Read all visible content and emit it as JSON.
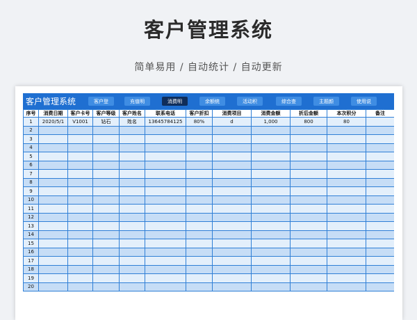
{
  "page": {
    "title": "客户管理系统",
    "subtitle": "简单易用  /  自动统计  /  自动更新"
  },
  "app": {
    "title": "客户管理系统",
    "nav": [
      "客户登",
      "充值明",
      "消费明",
      "余额统",
      "活动积",
      "综合查",
      "主题颜",
      "使用说"
    ],
    "active_tab": "消费明"
  },
  "table": {
    "headers": [
      "序号",
      "消费日期",
      "客户卡号",
      "客户等级",
      "客户姓名",
      "联系电话",
      "客户折扣",
      "消费项目",
      "消费金额",
      "折后金额",
      "本次积分",
      "备注"
    ],
    "rows": [
      [
        "1",
        "2020/5/1",
        "V1001",
        "钻石",
        "姓名",
        "13645784125",
        "80%",
        "d",
        "1,000",
        "800",
        "80",
        ""
      ],
      [
        "2",
        "",
        "",
        "",
        "",
        "",
        "",
        "",
        "",
        "",
        "",
        ""
      ],
      [
        "3",
        "",
        "",
        "",
        "",
        "",
        "",
        "",
        "",
        "",
        "",
        ""
      ],
      [
        "4",
        "",
        "",
        "",
        "",
        "",
        "",
        "",
        "",
        "",
        "",
        ""
      ],
      [
        "5",
        "",
        "",
        "",
        "",
        "",
        "",
        "",
        "",
        "",
        "",
        ""
      ],
      [
        "6",
        "",
        "",
        "",
        "",
        "",
        "",
        "",
        "",
        "",
        "",
        ""
      ],
      [
        "7",
        "",
        "",
        "",
        "",
        "",
        "",
        "",
        "",
        "",
        "",
        ""
      ],
      [
        "8",
        "",
        "",
        "",
        "",
        "",
        "",
        "",
        "",
        "",
        "",
        ""
      ],
      [
        "9",
        "",
        "",
        "",
        "",
        "",
        "",
        "",
        "",
        "",
        "",
        ""
      ],
      [
        "10",
        "",
        "",
        "",
        "",
        "",
        "",
        "",
        "",
        "",
        "",
        ""
      ],
      [
        "11",
        "",
        "",
        "",
        "",
        "",
        "",
        "",
        "",
        "",
        "",
        ""
      ],
      [
        "12",
        "",
        "",
        "",
        "",
        "",
        "",
        "",
        "",
        "",
        "",
        ""
      ],
      [
        "13",
        "",
        "",
        "",
        "",
        "",
        "",
        "",
        "",
        "",
        "",
        ""
      ],
      [
        "14",
        "",
        "",
        "",
        "",
        "",
        "",
        "",
        "",
        "",
        "",
        ""
      ],
      [
        "15",
        "",
        "",
        "",
        "",
        "",
        "",
        "",
        "",
        "",
        "",
        ""
      ],
      [
        "16",
        "",
        "",
        "",
        "",
        "",
        "",
        "",
        "",
        "",
        "",
        ""
      ],
      [
        "17",
        "",
        "",
        "",
        "",
        "",
        "",
        "",
        "",
        "",
        "",
        ""
      ],
      [
        "18",
        "",
        "",
        "",
        "",
        "",
        "",
        "",
        "",
        "",
        "",
        ""
      ],
      [
        "19",
        "",
        "",
        "",
        "",
        "",
        "",
        "",
        "",
        "",
        "",
        ""
      ],
      [
        "20",
        "",
        "",
        "",
        "",
        "",
        "",
        "",
        "",
        "",
        "",
        ""
      ]
    ]
  },
  "colors": {
    "header_blue": "#1f6fd1",
    "active_tab": "#0f2d5a",
    "row_light": "#e3effb",
    "row_dark": "#c6ddf6"
  }
}
